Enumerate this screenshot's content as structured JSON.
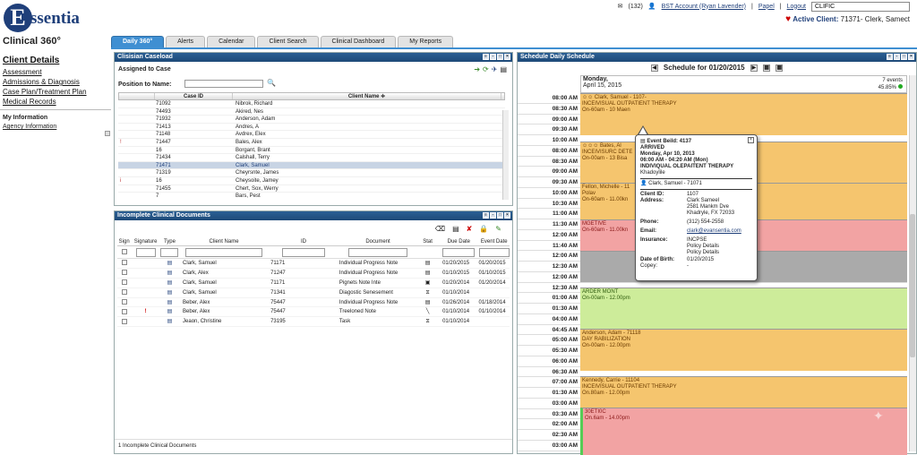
{
  "app": {
    "logo_letter": "E",
    "logo_text": "ssentia",
    "product": "Clinical 360°"
  },
  "topright": {
    "mail_count": "(132)",
    "account": "BST Account (Ryan Lavender)",
    "papel": "Papel",
    "logout": "Logout",
    "search_value": "CLIFIC"
  },
  "active_client": {
    "label": "Active Client:",
    "value": "71371- Clerk, Samect"
  },
  "tabs": [
    "Daily 360°",
    "Alerts",
    "Calendar",
    "Client Search",
    "Clinical Dashboard",
    "My Reports"
  ],
  "nav": {
    "title": "Client Details",
    "links": [
      "Assessment",
      "Admissions & Diagnosis",
      "Case Plan/Treatment Plan",
      "Medical Records"
    ],
    "my_info": "My Information",
    "agency": "Agency Information"
  },
  "caseload": {
    "title": "Clisisian Caseload",
    "assigned": "Assigned to Case",
    "position_label": "Position to Name:",
    "col_caseid": "Case ID",
    "col_name": "Client Name ≑",
    "rows": [
      {
        "icon": "",
        "id": "71092",
        "name": "Nibrok, Richard"
      },
      {
        "icon": "",
        "id": "74493",
        "name": "Akired, Nes"
      },
      {
        "icon": "",
        "id": "71932",
        "name": "Anderson, Adam"
      },
      {
        "icon": "",
        "id": "71413",
        "name": "Andres, A"
      },
      {
        "icon": "",
        "id": "71148",
        "name": "Avdrex, Elex"
      },
      {
        "icon": "!",
        "id": "71447",
        "name": "Bales, Alex"
      },
      {
        "icon": "",
        "id": "16",
        "name": "Borgant, Brant"
      },
      {
        "icon": "",
        "id": "71434",
        "name": "Calshall, Terry"
      },
      {
        "icon": "",
        "id": "71471",
        "name": "Clark, Samuel",
        "selected": true
      },
      {
        "icon": "",
        "id": "71319",
        "name": "Cheyrsnte, James"
      },
      {
        "icon": "i",
        "id": "16",
        "name": "Cheysoite, Jamey"
      },
      {
        "icon": "",
        "id": "71455",
        "name": "Chert, Sox, Werry"
      },
      {
        "icon": "",
        "id": "7",
        "name": "Bars, Pest"
      }
    ]
  },
  "docs": {
    "title": "Incomplete Clinical Documents",
    "cols": [
      "Sign",
      "Signature",
      "Type",
      "Client Name",
      "ID",
      "Document",
      "Stat",
      "Due Date",
      "Event Date"
    ],
    "rows": [
      {
        "sig": "",
        "name": "Clark, Samuel",
        "id": "71171",
        "doc": "Individual Progress Note",
        "stat": "▤",
        "due": "01/20/2015",
        "event": "01/20/2015"
      },
      {
        "sig": "",
        "name": "Clark,  Alex",
        "id": "71247",
        "doc": "Individual Progress Note",
        "stat": "▤",
        "due": "01/10/2015",
        "event": "01/10/2015"
      },
      {
        "sig": "",
        "name": "Clark, Samuel",
        "id": "71171",
        "doc": "Pignets Note Inte",
        "stat": "▣",
        "due": "01/20/2014",
        "event": "01/20/2014"
      },
      {
        "sig": "",
        "name": "Clark, Samuel",
        "id": "71341",
        "doc": "Diagostic Senesement",
        "stat": "⧖",
        "due": "01/10/2014",
        "event": ""
      },
      {
        "sig": "",
        "name": "Beber, Alex",
        "id": "75447",
        "doc": "Individual Progress Note",
        "stat": "▤",
        "due": "01/26/2014",
        "event": "01/18/2014"
      },
      {
        "sig": "!",
        "name": "Beber, Alex",
        "id": "75447",
        "doc": "Treeloned Note",
        "stat": "╲",
        "due": "01/10/2014",
        "event": "01/10/2014"
      },
      {
        "sig": "",
        "name": "Jeaon, Christine",
        "id": "73195",
        "doc": "Task",
        "stat": "⧖",
        "due": "01/10/2014",
        "event": ""
      }
    ],
    "footer": "1 Incomplete Clinical Documents"
  },
  "schedule": {
    "title": "Schedule Daily Schedule",
    "nav_label": "Schedule for 01/20/2015",
    "day": "Monday,",
    "date": "April 15, 2015",
    "events": "7 events",
    "pct": "45.85%",
    "times": [
      "08:00 AM",
      "08:30 AM",
      "09:00 AM",
      "09:30 AM",
      "10:00 AM",
      "08:00 AM",
      "08:30 AM",
      "09:00 AM",
      "09:30 AM",
      "10:00 AM",
      "10:30 AM",
      "11:00 AM",
      "11:30 AM",
      "12:00 AM",
      "11:40 AM",
      "12:00 AM",
      "12:30 AM",
      "12:00 AM",
      "12:30 AM",
      "01:00 AM",
      "01:30 AM",
      "04:00 AM",
      "04:45 AM",
      "05:00 AM",
      "05:30 AM",
      "06:00 AM",
      "06:30 AM",
      "07:00 AM",
      "01:30 AM",
      "03:00 AM",
      "03:30 AM",
      "02:00 AM",
      "02:30 AM",
      "03:00 AM"
    ],
    "appts": [
      {
        "l1": "Clark, Samuel - 1107-",
        "l2": "INCEIVISUAL OUTPATIENT THERAPY",
        "l3": "On-60am - 10 Maen"
      },
      {
        "l1": "Bates, Al",
        "l2": "INCEIVISURC DETE",
        "l3": "On-00am - 13 Bisa"
      },
      {
        "l1": "Fellon, Michelle - 11",
        "l2": "Polav",
        "l3": "On-60am - 11.00kn"
      },
      {
        "l1": "MGETIVE",
        "l2": "On-60am - 11.00kn",
        "l3": ""
      },
      {
        "l1": "ARDER MONT",
        "l2": "On-00am - 12.00pm",
        "l3": ""
      },
      {
        "l1": "Anderson, Adam - 71118",
        "l2": "DAY RABILIZATION",
        "l3": "On-00am - 12.00pm"
      },
      {
        "l1": "Kennedy, Carrie - 11104",
        "l2": "INCEIVISUAL OUTPATIENT THERAPY",
        "l3": "On.80am - 12.00pm"
      },
      {
        "l1": "30ETI0C",
        "l2": "On.6am - 14.00pm",
        "l3": ""
      }
    ]
  },
  "popup": {
    "event": "Event Beild: 4137",
    "status": "ARRIVED",
    "date": "Monday, Apr 10, 2013",
    "time": "06:00 AM - 04:20 AM  (Mon)",
    "type": "INDIVIQUAL OLEPAITENT THERAPY",
    "place": "Khadoylile",
    "client": "Clark, Samuel - 71071",
    "client_id_l": "Client ID:",
    "client_id": "1107",
    "address_l": "Address:",
    "addr1": "Clark Sameel",
    "addr2": "2581 Mankm Dve",
    "addr3": "Khadryle, FX 72033",
    "phone_l": "Phone:",
    "phone": "(312) 554-2558",
    "email_l": "Email:",
    "email": "clark@evansentia.com",
    "ins_l": "Insurance:",
    "ins1": "INCPSE",
    "ins2": "Policy Details",
    "ins3": "Policy Details",
    "dob_l": "Date of Birth:",
    "dob": "01/20/2015",
    "copay_l": "Copey:",
    "copay": "-"
  }
}
